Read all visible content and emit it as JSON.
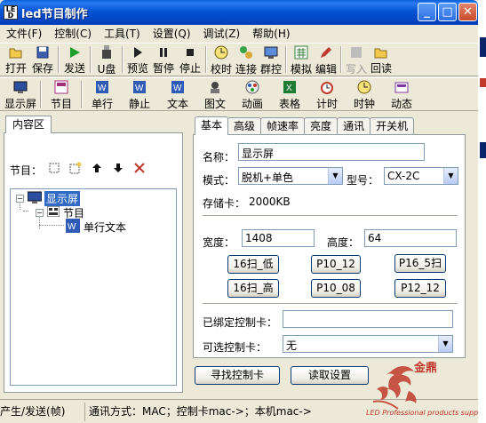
{
  "window": {
    "title": "led节目制作",
    "icon_text_top": "LE",
    "icon_text_bottom": "D",
    "controls": [
      "minimize-icon",
      "maximize-icon",
      "close-icon"
    ]
  },
  "menu": [
    "文件(F)",
    "控制(C)",
    "工具(T)",
    "设置(Q)",
    "调试(Z)",
    "帮助(H)"
  ],
  "toolbar1": [
    {
      "label": "打开",
      "icon": "folder-open-icon"
    },
    {
      "label": "保存",
      "icon": "save-icon"
    },
    {
      "label": "发送",
      "icon": "play-send-icon"
    },
    {
      "label": "U盘",
      "icon": "usb-disk-icon"
    },
    {
      "label": "预览",
      "icon": "preview-icon"
    },
    {
      "label": "暂停",
      "icon": "pause-icon"
    },
    {
      "label": "停止",
      "icon": "stop-icon"
    },
    {
      "label": "校时",
      "icon": "clock-icon"
    },
    {
      "label": "连接",
      "icon": "connect-icon"
    },
    {
      "label": "群控",
      "icon": "group-control-icon"
    },
    {
      "label": "模拟",
      "icon": "simulate-icon"
    },
    {
      "label": "编辑",
      "icon": "edit-icon"
    },
    {
      "label": "写入",
      "icon": "write-icon",
      "disabled": true
    },
    {
      "label": "回读",
      "icon": "readback-icon"
    }
  ],
  "toolbar2": [
    {
      "label": "显示屏",
      "icon": "display-screen-icon"
    },
    {
      "label": "节目",
      "icon": "program-icon"
    },
    {
      "label": "单行",
      "icon": "single-line-icon"
    },
    {
      "label": "静止",
      "icon": "static-text-icon"
    },
    {
      "label": "文本",
      "icon": "text-icon"
    },
    {
      "label": "图文",
      "icon": "picture-text-icon"
    },
    {
      "label": "动画",
      "icon": "animation-icon"
    },
    {
      "label": "表格",
      "icon": "table-icon"
    },
    {
      "label": "计时",
      "icon": "timer-icon"
    },
    {
      "label": "时钟",
      "icon": "clock-icon"
    },
    {
      "label": "动态",
      "icon": "dynamic-icon"
    }
  ],
  "left": {
    "tab": "内容区",
    "program_label": "节目：",
    "tree": [
      {
        "label": "显示屏",
        "level": 0,
        "selected": true
      },
      {
        "label": "节目",
        "level": 1,
        "selected": false
      },
      {
        "label": "单行文本",
        "level": 2,
        "selected": false
      }
    ]
  },
  "right": {
    "tabs": [
      "基本",
      "高级",
      "帧速率",
      "亮度",
      "通讯",
      "开关机"
    ],
    "active_tab": 0,
    "name_label": "名称：",
    "name_value": "显示屏",
    "mode_label": "模式：",
    "mode_value": "脱机+单色",
    "model_label": "型号：",
    "model_value": "CX-2C",
    "storage_label": "存储卡：",
    "storage_value": "2000KB",
    "width_label": "宽度：",
    "width_value": "1408",
    "height_label": "高度：",
    "height_value": "64",
    "scan_buttons": [
      "16扫_低",
      "P10_12",
      "P16_5扫",
      "16扫_高",
      "P10_08",
      "P12_12"
    ],
    "bound_card_label": "已绑定控制卡：",
    "bound_card_value": "",
    "optional_card_label": "可选控制卡：",
    "optional_card_value": "无",
    "find_button": "寻找控制卡",
    "read_button": "读取设置"
  },
  "status": {
    "left": "产生/发送(帧)",
    "comm": "通讯方式：MAC；控制卡mac->；本机mac->"
  },
  "logo": {
    "brand": "金鼎",
    "tagline": "LED Professional products supplier"
  }
}
